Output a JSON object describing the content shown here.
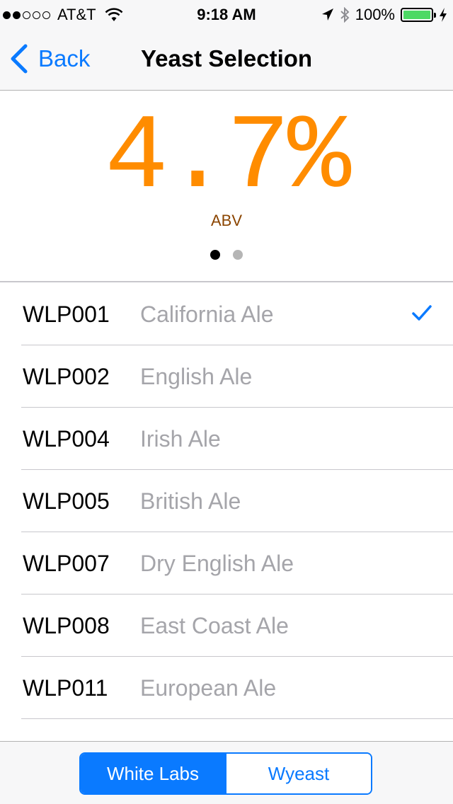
{
  "status_bar": {
    "carrier": "AT&T",
    "time": "9:18 AM",
    "battery": "100%",
    "signal_strength": 2,
    "signal_max": 5,
    "battery_level": 1.0
  },
  "nav": {
    "back_label": "Back",
    "title": "Yeast Selection"
  },
  "abv": {
    "value": "4.7%",
    "label": "ABV",
    "page_count": 2,
    "current_page": 1
  },
  "yeasts": [
    {
      "code": "WLP001",
      "name": "California Ale",
      "selected": true
    },
    {
      "code": "WLP002",
      "name": "English Ale",
      "selected": false
    },
    {
      "code": "WLP004",
      "name": "Irish Ale",
      "selected": false
    },
    {
      "code": "WLP005",
      "name": "British Ale",
      "selected": false
    },
    {
      "code": "WLP007",
      "name": "Dry English Ale",
      "selected": false
    },
    {
      "code": "WLP008",
      "name": "East Coast Ale",
      "selected": false
    },
    {
      "code": "WLP011",
      "name": "European Ale",
      "selected": false
    }
  ],
  "toolbar": {
    "segments": [
      "White Labs",
      "Wyeast"
    ],
    "selected_segment": "White Labs"
  },
  "colors": {
    "accent": "#0a7aff",
    "abv_value": "#ff8c00",
    "abv_label": "#8b4500",
    "battery": "#4cd964"
  }
}
